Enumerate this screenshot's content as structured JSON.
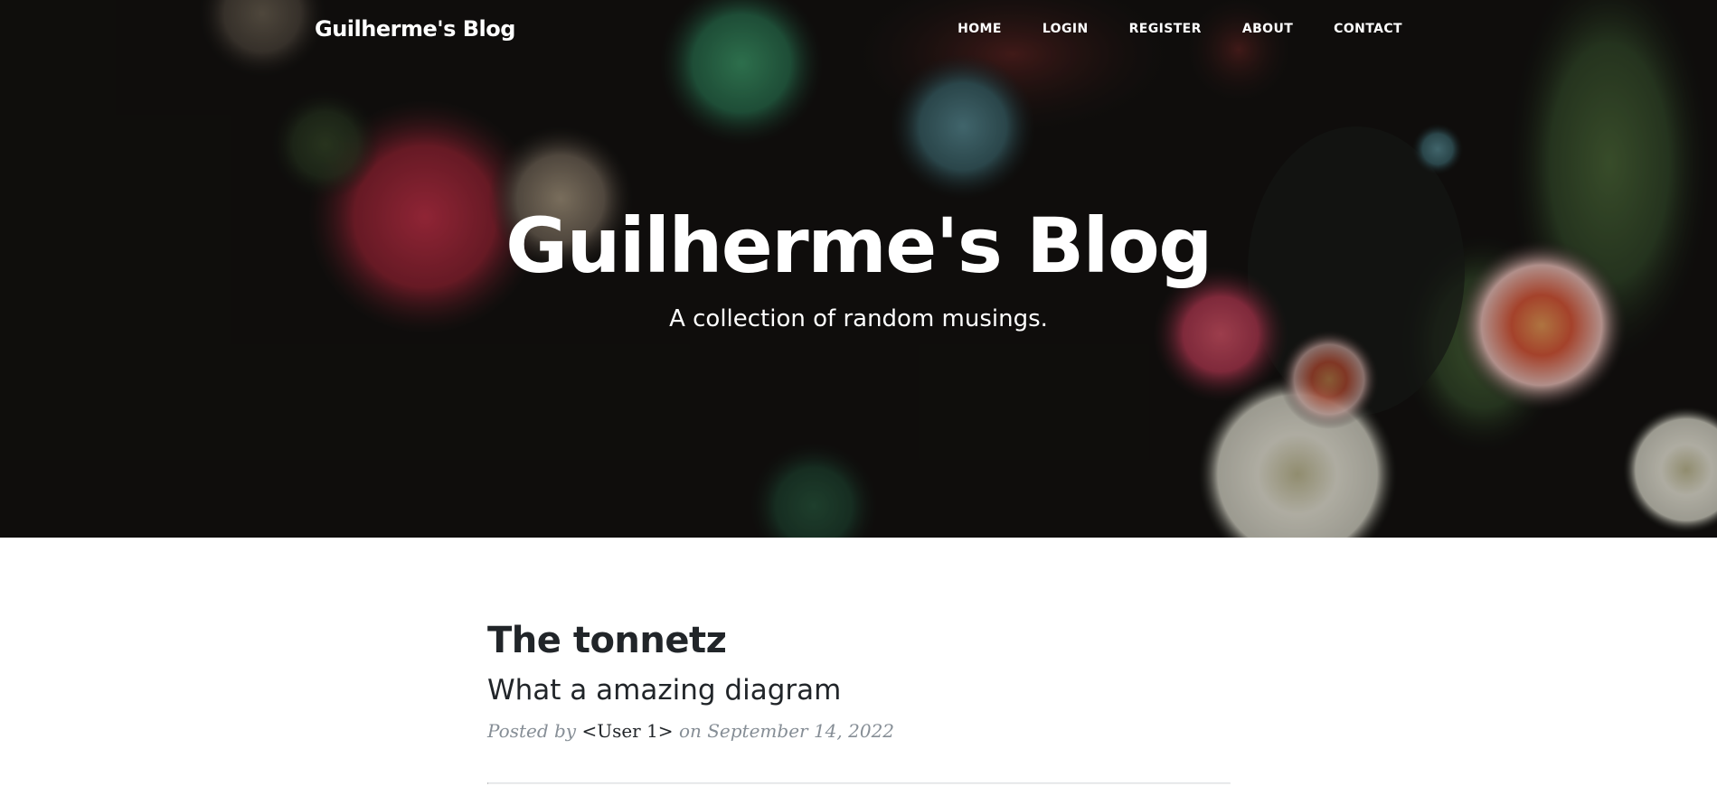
{
  "navbar": {
    "brand": "Guilherme's Blog",
    "links": [
      "HOME",
      "LOGIN",
      "REGISTER",
      "ABOUT",
      "CONTACT"
    ]
  },
  "hero": {
    "title": "Guilherme's Blog",
    "subtitle": "A collection of random musings.",
    "background_image": "sea-anemones-photo"
  },
  "posts": [
    {
      "title": "The tonnetz",
      "subtitle": "What a amazing diagram",
      "meta_prefix": "Posted by",
      "author": "<User 1>",
      "meta_on": "on",
      "date": "September 14, 2022"
    }
  ],
  "colors": {
    "hero_text": "#ffffff",
    "post_title": "#212529",
    "meta_text": "#868e96",
    "divider": "#e1e4e7"
  }
}
